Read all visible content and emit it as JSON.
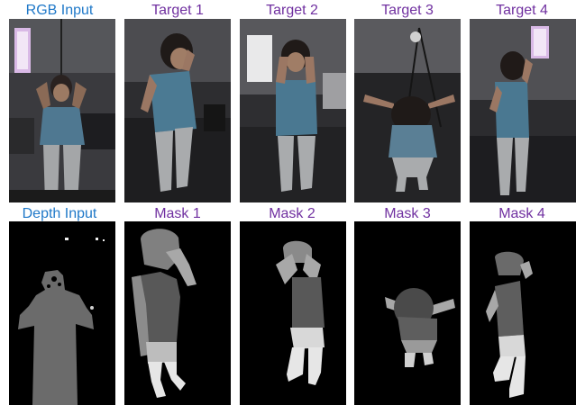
{
  "colors": {
    "input_label": "#1F78C8",
    "target_label": "#7030A0",
    "mask_background": "#000000"
  },
  "top_row": [
    {
      "label": "RGB Input",
      "kind": "input"
    },
    {
      "label": "Target 1",
      "kind": "target"
    },
    {
      "label": "Target 2",
      "kind": "target"
    },
    {
      "label": "Target 3",
      "kind": "target"
    },
    {
      "label": "Target 4",
      "kind": "target"
    }
  ],
  "bottom_row": [
    {
      "label": "Depth Input",
      "kind": "input"
    },
    {
      "label": "Mask 1",
      "kind": "target"
    },
    {
      "label": "Mask 2",
      "kind": "target"
    },
    {
      "label": "Mask 3",
      "kind": "target"
    },
    {
      "label": "Mask 4",
      "kind": "target"
    }
  ]
}
